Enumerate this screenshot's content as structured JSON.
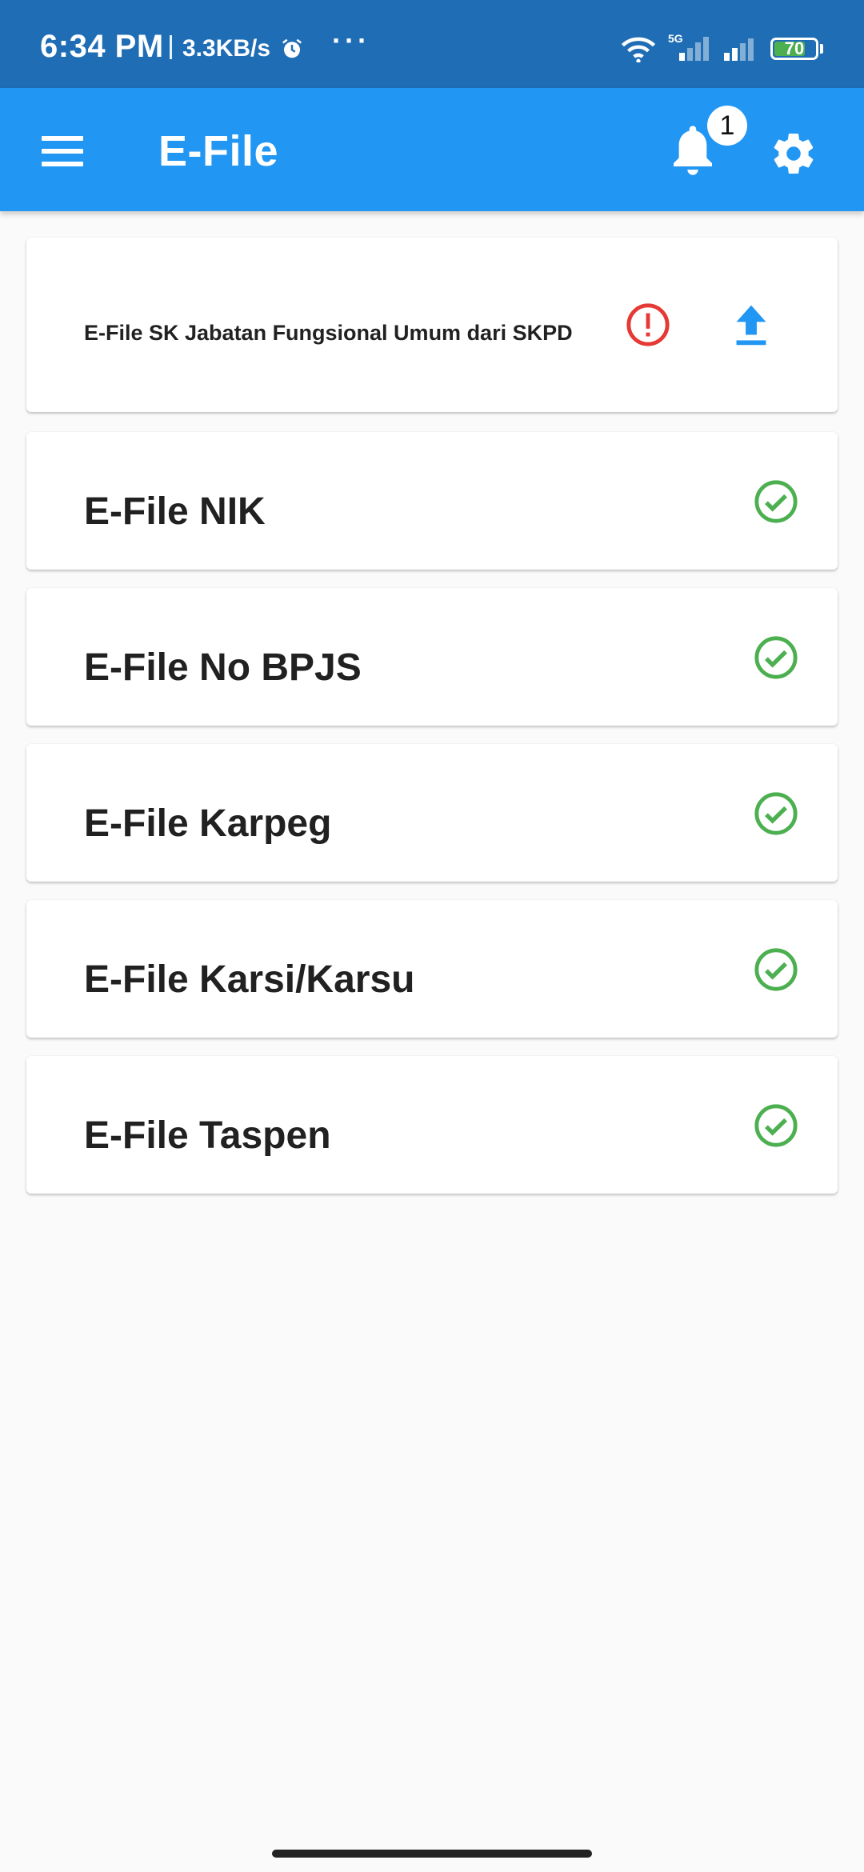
{
  "status_bar": {
    "time": "6:34 PM",
    "speed": "3.3KB/s",
    "network": "5G",
    "battery": "70",
    "overflow": "···"
  },
  "app_bar": {
    "title": "E-File",
    "notification_count": "1"
  },
  "colors": {
    "status_bar": "#1e6db5",
    "app_bar": "#2196f3",
    "alert": "#e53935",
    "upload": "#2196f3",
    "check": "#4caf50"
  },
  "cards": [
    {
      "title": "E-File SK Jabatan Fungsional Umum dari SKPD",
      "status": "alert",
      "action": "upload-icon"
    },
    {
      "title": "E-File NIK",
      "status": "check"
    },
    {
      "title": "E-File No BPJS",
      "status": "check"
    },
    {
      "title": "E-File Karpeg",
      "status": "check"
    },
    {
      "title": "E-File Karsi/Karsu",
      "status": "check"
    },
    {
      "title": "E-File Taspen",
      "status": "check"
    }
  ]
}
